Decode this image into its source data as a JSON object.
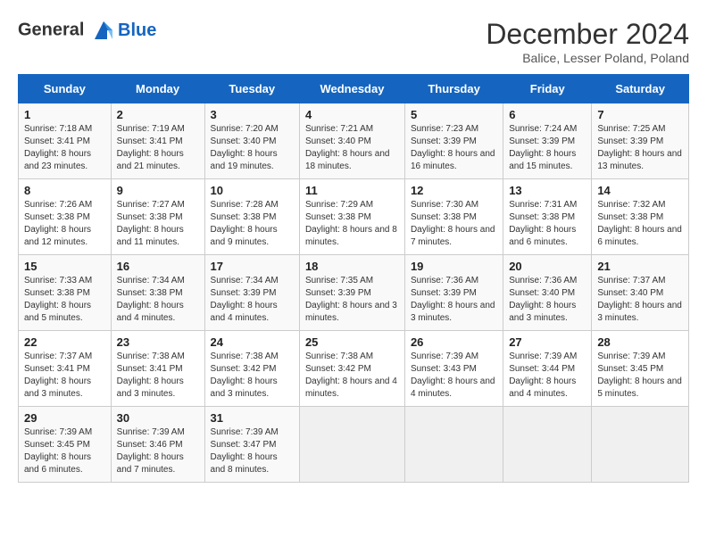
{
  "logo": {
    "line1": "General",
    "line2": "Blue"
  },
  "title": "December 2024",
  "subtitle": "Balice, Lesser Poland, Poland",
  "days_header": [
    "Sunday",
    "Monday",
    "Tuesday",
    "Wednesday",
    "Thursday",
    "Friday",
    "Saturday"
  ],
  "weeks": [
    [
      {
        "day": "1",
        "sunrise": "7:18 AM",
        "sunset": "3:41 PM",
        "daylight": "8 hours and 23 minutes."
      },
      {
        "day": "2",
        "sunrise": "7:19 AM",
        "sunset": "3:41 PM",
        "daylight": "8 hours and 21 minutes."
      },
      {
        "day": "3",
        "sunrise": "7:20 AM",
        "sunset": "3:40 PM",
        "daylight": "8 hours and 19 minutes."
      },
      {
        "day": "4",
        "sunrise": "7:21 AM",
        "sunset": "3:40 PM",
        "daylight": "8 hours and 18 minutes."
      },
      {
        "day": "5",
        "sunrise": "7:23 AM",
        "sunset": "3:39 PM",
        "daylight": "8 hours and 16 minutes."
      },
      {
        "day": "6",
        "sunrise": "7:24 AM",
        "sunset": "3:39 PM",
        "daylight": "8 hours and 15 minutes."
      },
      {
        "day": "7",
        "sunrise": "7:25 AM",
        "sunset": "3:39 PM",
        "daylight": "8 hours and 13 minutes."
      }
    ],
    [
      {
        "day": "8",
        "sunrise": "7:26 AM",
        "sunset": "3:38 PM",
        "daylight": "8 hours and 12 minutes."
      },
      {
        "day": "9",
        "sunrise": "7:27 AM",
        "sunset": "3:38 PM",
        "daylight": "8 hours and 11 minutes."
      },
      {
        "day": "10",
        "sunrise": "7:28 AM",
        "sunset": "3:38 PM",
        "daylight": "8 hours and 9 minutes."
      },
      {
        "day": "11",
        "sunrise": "7:29 AM",
        "sunset": "3:38 PM",
        "daylight": "8 hours and 8 minutes."
      },
      {
        "day": "12",
        "sunrise": "7:30 AM",
        "sunset": "3:38 PM",
        "daylight": "8 hours and 7 minutes."
      },
      {
        "day": "13",
        "sunrise": "7:31 AM",
        "sunset": "3:38 PM",
        "daylight": "8 hours and 6 minutes."
      },
      {
        "day": "14",
        "sunrise": "7:32 AM",
        "sunset": "3:38 PM",
        "daylight": "8 hours and 6 minutes."
      }
    ],
    [
      {
        "day": "15",
        "sunrise": "7:33 AM",
        "sunset": "3:38 PM",
        "daylight": "8 hours and 5 minutes."
      },
      {
        "day": "16",
        "sunrise": "7:34 AM",
        "sunset": "3:38 PM",
        "daylight": "8 hours and 4 minutes."
      },
      {
        "day": "17",
        "sunrise": "7:34 AM",
        "sunset": "3:39 PM",
        "daylight": "8 hours and 4 minutes."
      },
      {
        "day": "18",
        "sunrise": "7:35 AM",
        "sunset": "3:39 PM",
        "daylight": "8 hours and 3 minutes."
      },
      {
        "day": "19",
        "sunrise": "7:36 AM",
        "sunset": "3:39 PM",
        "daylight": "8 hours and 3 minutes."
      },
      {
        "day": "20",
        "sunrise": "7:36 AM",
        "sunset": "3:40 PM",
        "daylight": "8 hours and 3 minutes."
      },
      {
        "day": "21",
        "sunrise": "7:37 AM",
        "sunset": "3:40 PM",
        "daylight": "8 hours and 3 minutes."
      }
    ],
    [
      {
        "day": "22",
        "sunrise": "7:37 AM",
        "sunset": "3:41 PM",
        "daylight": "8 hours and 3 minutes."
      },
      {
        "day": "23",
        "sunrise": "7:38 AM",
        "sunset": "3:41 PM",
        "daylight": "8 hours and 3 minutes."
      },
      {
        "day": "24",
        "sunrise": "7:38 AM",
        "sunset": "3:42 PM",
        "daylight": "8 hours and 3 minutes."
      },
      {
        "day": "25",
        "sunrise": "7:38 AM",
        "sunset": "3:42 PM",
        "daylight": "8 hours and 4 minutes."
      },
      {
        "day": "26",
        "sunrise": "7:39 AM",
        "sunset": "3:43 PM",
        "daylight": "8 hours and 4 minutes."
      },
      {
        "day": "27",
        "sunrise": "7:39 AM",
        "sunset": "3:44 PM",
        "daylight": "8 hours and 4 minutes."
      },
      {
        "day": "28",
        "sunrise": "7:39 AM",
        "sunset": "3:45 PM",
        "daylight": "8 hours and 5 minutes."
      }
    ],
    [
      {
        "day": "29",
        "sunrise": "7:39 AM",
        "sunset": "3:45 PM",
        "daylight": "8 hours and 6 minutes."
      },
      {
        "day": "30",
        "sunrise": "7:39 AM",
        "sunset": "3:46 PM",
        "daylight": "8 hours and 7 minutes."
      },
      {
        "day": "31",
        "sunrise": "7:39 AM",
        "sunset": "3:47 PM",
        "daylight": "8 hours and 8 minutes."
      },
      null,
      null,
      null,
      null
    ]
  ]
}
